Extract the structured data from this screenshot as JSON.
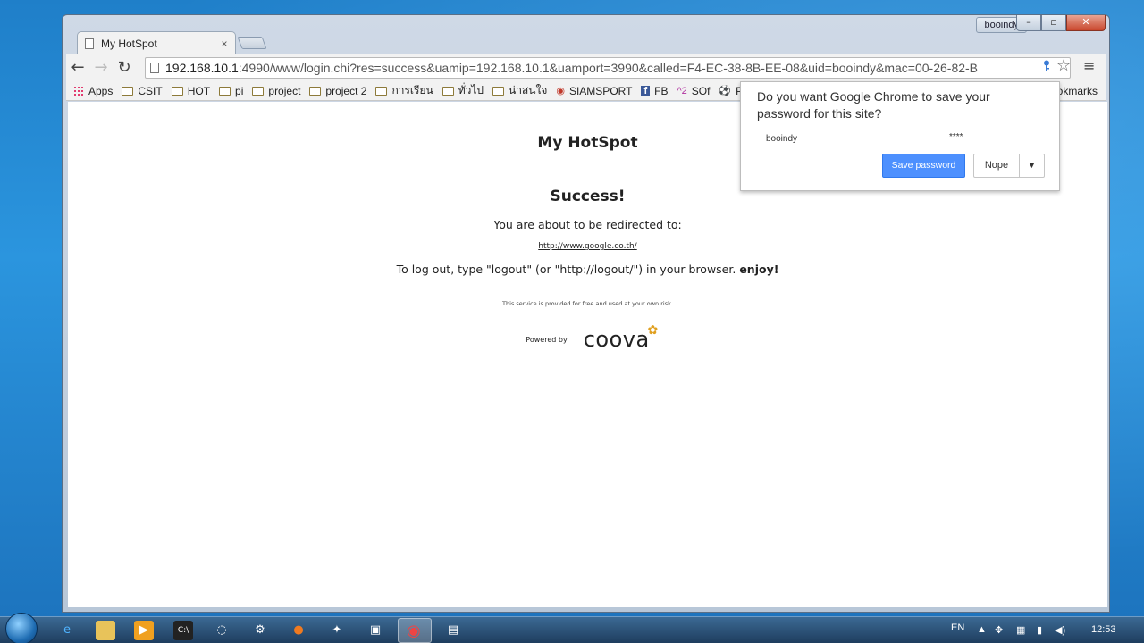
{
  "window": {
    "profile": "booindy",
    "controls": [
      "–",
      "▫",
      "✕"
    ]
  },
  "tab": {
    "title": "My HotSpot",
    "close": "×"
  },
  "toolbar": {
    "back": "←",
    "forward": "→",
    "reload": "↻",
    "url_host": "192.168.10.1",
    "url_rest": ":4990/www/login.chi?res=success&uamip=192.168.10.1&uamport=3990&called=F4-EC-38-8B-EE-08&uid=booindy&mac=00-26-82-B",
    "star": "☆",
    "menu": "≡"
  },
  "bookmarks": {
    "items": [
      {
        "label": "Apps",
        "kind": "apps"
      },
      {
        "label": "CSIT",
        "kind": "folder"
      },
      {
        "label": "HOT",
        "kind": "folder"
      },
      {
        "label": "pi",
        "kind": "folder"
      },
      {
        "label": "project",
        "kind": "folder"
      },
      {
        "label": "project 2",
        "kind": "folder"
      },
      {
        "label": "การเรียน",
        "kind": "folder"
      },
      {
        "label": "ทั่วไป",
        "kind": "folder"
      },
      {
        "label": "น่าสนใจ",
        "kind": "folder"
      },
      {
        "label": "SIAMSPORT",
        "kind": "site"
      },
      {
        "label": "FB",
        "kind": "site"
      },
      {
        "label": "SOf",
        "kind": "site"
      },
      {
        "label": "P",
        "kind": "site"
      }
    ],
    "tail": "okmarks"
  },
  "page": {
    "site_title": "My HotSpot",
    "heading": "Success!",
    "redirect_text": "You are about to be redirected to:",
    "redirect_link": "http://www.google.co.th/",
    "logout_text": "To log out, type \"logout\" (or \"http://logout/\") in your browser.",
    "logout_enjoy": "enjoy!",
    "disclaimer": "This service is provided for free and used at your own risk.",
    "powered_by": "Powered by",
    "logo": "coova"
  },
  "password_bubble": {
    "question": "Do you want Google Chrome to save your password for this site?",
    "username": "booindy",
    "password": "****",
    "save_label": "Save password",
    "nope_label": "Nope",
    "dropdown": "▼"
  },
  "taskbar": {
    "language": "EN",
    "clock": "12:53"
  },
  "colors": {
    "accent": "#4d90fe",
    "desktop": "#1f7fc9"
  }
}
